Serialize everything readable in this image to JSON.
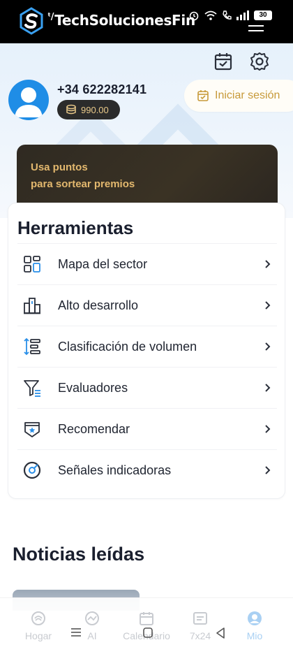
{
  "app": {
    "title": "TechSolucionesFin",
    "title_prefix": "ᵗ/"
  },
  "status": {
    "battery": "30"
  },
  "header": {
    "calendar_icon": "calendar-check-icon",
    "settings_icon": "gear-icon",
    "phone": "+34 622282141",
    "points": "990.00",
    "login_label": "Iniciar sesión"
  },
  "promo": {
    "line1": "Usa puntos",
    "line2": "para sortear premios"
  },
  "tools": {
    "title": "Herramientas",
    "items": [
      {
        "label": "Mapa del sector",
        "icon": "sector-map-icon"
      },
      {
        "label": "Alto desarrollo",
        "icon": "buildings-icon"
      },
      {
        "label": "Clasificación de volumen",
        "icon": "volume-ranking-icon"
      },
      {
        "label": "Evaluadores",
        "icon": "filter-icon"
      },
      {
        "label": "Recomendar",
        "icon": "badge-star-icon"
      },
      {
        "label": "Señales indicadoras",
        "icon": "compass-icon"
      }
    ]
  },
  "news": {
    "title": "Noticias leídas"
  },
  "bottom_nav": {
    "items": [
      {
        "label": "Hogar",
        "icon": "home-icon"
      },
      {
        "label": "AI",
        "icon": "ai-icon"
      },
      {
        "label": "Calendario",
        "icon": "calendar-icon"
      },
      {
        "label": "7x24",
        "icon": "news-icon"
      },
      {
        "label": "Mio",
        "icon": "profile-icon",
        "active": true
      }
    ]
  },
  "colors": {
    "accent_blue": "#1f8de6",
    "gold": "#c79a3a",
    "promo_text": "#e3b86e"
  }
}
